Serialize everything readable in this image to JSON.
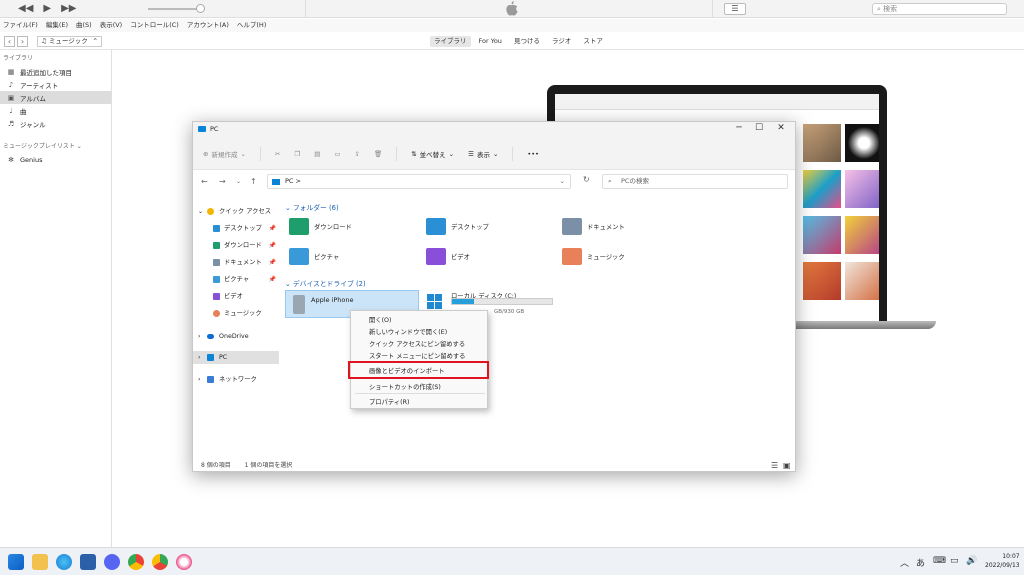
{
  "itunes": {
    "menu": [
      "ファイル(F)",
      "編集(E)",
      "曲(S)",
      "表示(V)",
      "コントロール(C)",
      "アカウント(A)",
      "ヘルプ(H)"
    ],
    "search_placeholder": "検索",
    "media_kind": "ミュージック",
    "tabs": [
      {
        "label": "ライブラリ",
        "active": true
      },
      {
        "label": "For You"
      },
      {
        "label": "見つける"
      },
      {
        "label": "ラジオ"
      },
      {
        "label": "ストア"
      }
    ],
    "sidebar": {
      "library_heading": "ライブラリ",
      "library_items": [
        {
          "label": "最近追加した項目",
          "icon": "calendar-icon"
        },
        {
          "label": "アーティスト",
          "icon": "microphone-icon"
        },
        {
          "label": "アルバム",
          "icon": "album-icon",
          "selected": true
        },
        {
          "label": "曲",
          "icon": "note-icon"
        },
        {
          "label": "ジャンル",
          "icon": "guitar-icon"
        }
      ],
      "playlist_heading": "ミュージックプレイリスト ⌄",
      "playlist_items": [
        {
          "label": "Genius",
          "icon": "genius-icon"
        }
      ]
    }
  },
  "explorer": {
    "title": "PC",
    "toolbar": {
      "new": "新規作成",
      "sort": "並べ替え",
      "view": "表示",
      "more": "•••"
    },
    "address": "PC  >",
    "search_placeholder": "PCの検索",
    "nav": [
      {
        "label": "クイック アクセス",
        "icon": "star-icon"
      },
      {
        "label": "デスクトップ",
        "icon": "desktop-icon",
        "pinned": true
      },
      {
        "label": "ダウンロード",
        "icon": "download-icon",
        "pinned": true
      },
      {
        "label": "ドキュメント",
        "icon": "document-icon",
        "pinned": true
      },
      {
        "label": "ピクチャ",
        "icon": "picture-icon",
        "pinned": true
      },
      {
        "label": "ビデオ",
        "icon": "video-icon"
      },
      {
        "label": "ミュージック",
        "icon": "music-icon"
      },
      {
        "label": "OneDrive",
        "icon": "cloud-icon"
      },
      {
        "label": "PC",
        "icon": "pc-icon",
        "selected": true
      },
      {
        "label": "ネットワーク",
        "icon": "network-icon"
      }
    ],
    "folders_heading": "フォルダー (6)",
    "folders": [
      {
        "label": "ダウンロード",
        "color": "#1e9e6a"
      },
      {
        "label": "デスクトップ",
        "color": "#2b8fd6"
      },
      {
        "label": "ドキュメント",
        "color": "#7b8fa6"
      },
      {
        "label": "ピクチャ",
        "color": "#3a9ad9"
      },
      {
        "label": "ビデオ",
        "color": "#8a4fd8"
      },
      {
        "label": "ミュージック",
        "color": "#e8805a"
      }
    ],
    "devices_heading": "デバイスとドライブ (2)",
    "devices": [
      {
        "label": "Apple iPhone"
      },
      {
        "label": "ローカル ディスク (C:)",
        "capacity": "GB/930 GB",
        "used": 0.22
      }
    ],
    "status_items": "8 個の項目",
    "status_selected": "1 個の項目を選択"
  },
  "context_menu": {
    "items": [
      "開く(O)",
      "新しいウィンドウで開く(E)",
      "クイック アクセスにピン留めする",
      "スタート メニューにピン留めする"
    ],
    "import": "画像とビデオのインポート",
    "shortcut": "ショートカットの作成(S)",
    "properties": "プロパティ(R)"
  },
  "taskbar": {
    "time": "10:07",
    "date": "2022/09/13",
    "ime": "あ"
  }
}
